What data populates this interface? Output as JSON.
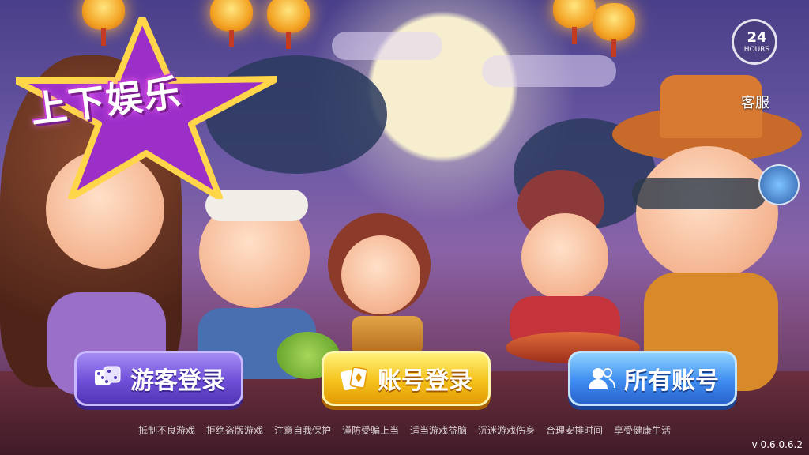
{
  "game": {
    "logo_text": "上下娱乐"
  },
  "support": {
    "hours_number": "24",
    "hours_unit": "HOURS",
    "label": "客服"
  },
  "login_buttons": [
    {
      "label": "游客登录",
      "icon": "dice-icon",
      "color": "#6f4fd8"
    },
    {
      "label": "账号登录",
      "icon": "cards-icon",
      "color": "#f5c21b"
    },
    {
      "label": "所有账号",
      "icon": "users-icon",
      "color": "#3e8df0"
    }
  ],
  "health_notice": [
    "抵制不良游戏",
    "拒绝盗版游戏",
    "注意自我保护",
    "谨防受骗上当",
    "适当游戏益脑",
    "沉迷游戏伤身",
    "合理安排时间",
    "享受健康生活"
  ],
  "version": "v 0.6.0.6.2"
}
